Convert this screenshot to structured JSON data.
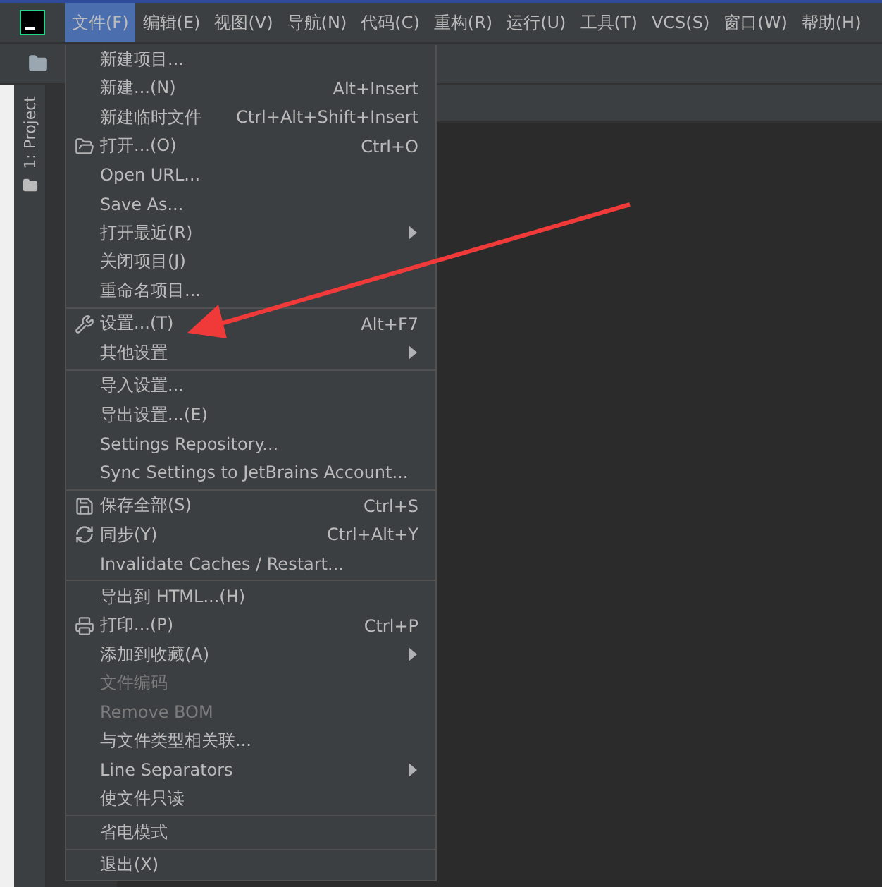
{
  "menubar": [
    {
      "label": "文件(F)",
      "selected": true
    },
    {
      "label": "编辑(E)",
      "selected": false
    },
    {
      "label": "视图(V)",
      "selected": false
    },
    {
      "label": "导航(N)",
      "selected": false
    },
    {
      "label": "代码(C)",
      "selected": false
    },
    {
      "label": "重构(R)",
      "selected": false
    },
    {
      "label": "运行(U)",
      "selected": false
    },
    {
      "label": "工具(T)",
      "selected": false
    },
    {
      "label": "VCS(S)",
      "selected": false
    },
    {
      "label": "窗口(W)",
      "selected": false
    },
    {
      "label": "帮助(H)",
      "selected": false
    }
  ],
  "sidebar": {
    "tab": "1: Project"
  },
  "menu": [
    {
      "kind": "item",
      "label": "新建项目...",
      "disabled": false
    },
    {
      "kind": "item",
      "label": "新建...(N)",
      "shortcut": "Alt+Insert",
      "disabled": false
    },
    {
      "kind": "item",
      "label": "新建临时文件",
      "shortcut": "Ctrl+Alt+Shift+Insert",
      "disabled": false
    },
    {
      "kind": "item",
      "label": "打开...(O)",
      "shortcut": "Ctrl+O",
      "disabled": false
    },
    {
      "kind": "item",
      "label": "Open URL...",
      "disabled": false
    },
    {
      "kind": "item",
      "label": "Save As...",
      "disabled": false
    },
    {
      "kind": "item",
      "label": "打开最近(R)",
      "submenu": true,
      "disabled": false
    },
    {
      "kind": "item",
      "label": "关闭项目(J)",
      "disabled": false
    },
    {
      "kind": "item",
      "label": "重命名项目...",
      "disabled": false
    },
    {
      "kind": "separator"
    },
    {
      "kind": "item",
      "label": "设置...(T)",
      "shortcut": "Alt+F7",
      "disabled": false
    },
    {
      "kind": "item",
      "label": "其他设置",
      "submenu": true,
      "disabled": false
    },
    {
      "kind": "separator"
    },
    {
      "kind": "item",
      "label": "导入设置...",
      "disabled": false
    },
    {
      "kind": "item",
      "label": "导出设置...(E)",
      "disabled": false
    },
    {
      "kind": "item",
      "label": "Settings Repository...",
      "disabled": false
    },
    {
      "kind": "item",
      "label": "Sync Settings to JetBrains Account...",
      "disabled": false
    },
    {
      "kind": "separator"
    },
    {
      "kind": "item",
      "label": "保存全部(S)",
      "shortcut": "Ctrl+S",
      "disabled": false
    },
    {
      "kind": "item",
      "label": "同步(Y)",
      "shortcut": "Ctrl+Alt+Y",
      "disabled": false
    },
    {
      "kind": "item",
      "label": "Invalidate Caches / Restart...",
      "disabled": false
    },
    {
      "kind": "separator"
    },
    {
      "kind": "item",
      "label": "导出到 HTML...(H)",
      "disabled": false
    },
    {
      "kind": "item",
      "label": "打印...(P)",
      "shortcut": "Ctrl+P",
      "disabled": false
    },
    {
      "kind": "item",
      "label": "添加到收藏(A)",
      "submenu": true,
      "disabled": false
    },
    {
      "kind": "item",
      "label": "文件编码",
      "disabled": true
    },
    {
      "kind": "item",
      "label": "Remove BOM",
      "disabled": true
    },
    {
      "kind": "item",
      "label": "与文件类型相关联...",
      "disabled": false
    },
    {
      "kind": "item",
      "label": "Line Separators",
      "submenu": true,
      "disabled": false
    },
    {
      "kind": "item",
      "label": "使文件只读",
      "disabled": false
    },
    {
      "kind": "separator"
    },
    {
      "kind": "item",
      "label": "省电模式",
      "disabled": false
    },
    {
      "kind": "separator"
    },
    {
      "kind": "item",
      "label": "退出(X)",
      "disabled": false
    }
  ]
}
